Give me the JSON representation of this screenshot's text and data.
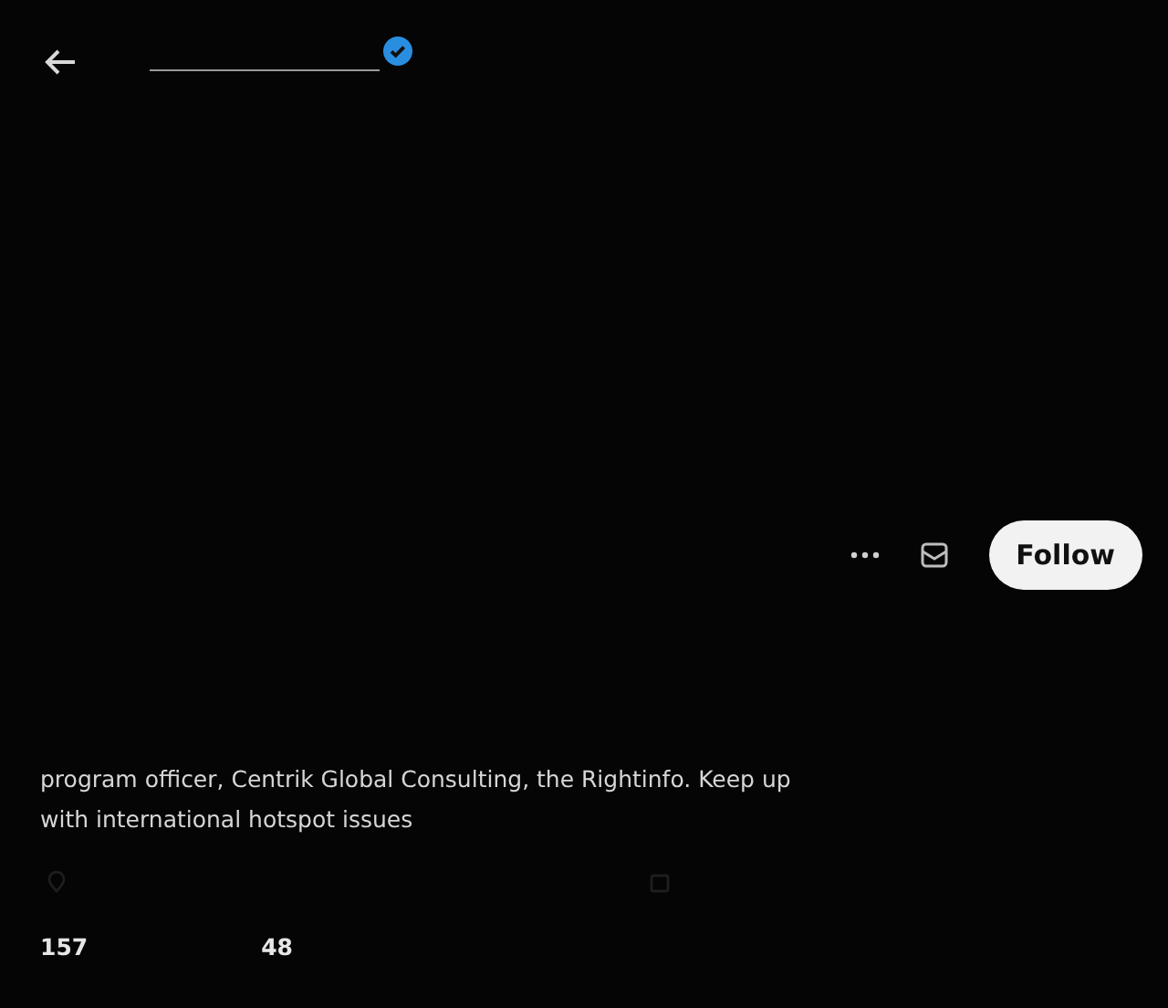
{
  "header": {
    "verified": true
  },
  "actions": {
    "follow_label": "Follow"
  },
  "bio": "program officer, Centrik Global Consulting, the Rightinfo. Keep up with international hotspot issues",
  "counts": [
    "157",
    "48"
  ]
}
